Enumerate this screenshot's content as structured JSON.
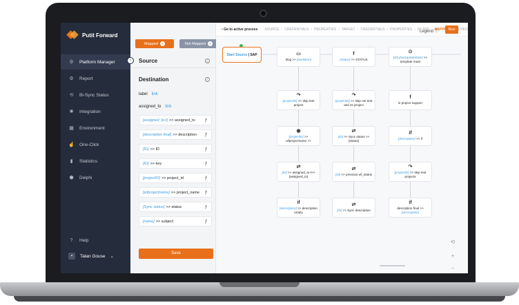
{
  "logo": {
    "text": "Putit Forward"
  },
  "sidebar": {
    "items": [
      {
        "label": "Platform Manager",
        "icon": "gear-icon",
        "glyph": "⚙"
      },
      {
        "label": "Report",
        "icon": "gear-icon",
        "glyph": "⚙"
      },
      {
        "label": "Bi-Sync Status",
        "icon": "sync-icon",
        "glyph": "⟲"
      },
      {
        "label": "Integration",
        "icon": "sun-icon",
        "glyph": "✺"
      },
      {
        "label": "Environment",
        "icon": "grid-icon",
        "glyph": "▦"
      },
      {
        "label": "One-Click",
        "icon": "pointer-icon",
        "glyph": "☝"
      },
      {
        "label": "Statistics",
        "icon": "bar-chart-icon",
        "glyph": "▮"
      },
      {
        "label": "Delphi",
        "icon": "cube-icon",
        "glyph": "⬢"
      }
    ],
    "help": "Help",
    "user": "Talan Gouse",
    "collapse_glyph": "‹",
    "user_caret": "⌄"
  },
  "panel": {
    "tabs": {
      "mapped": "Mapped",
      "mapped_count": "0",
      "not_mapped": "Not Mapped",
      "not_mapped_count": "0"
    },
    "source_title": "Source",
    "destination_title": "Destination",
    "fields": [
      {
        "key": "label",
        "value": "link"
      },
      {
        "key": "assigned_to",
        "value": "link"
      }
    ],
    "mappings": [
      {
        "src": "[assigned_to-t]",
        "dst": "assigned_to"
      },
      {
        "src": "[description final]",
        "dst": "description"
      },
      {
        "src": "[ID]",
        "dst": "ID"
      },
      {
        "src": "[ID]",
        "dst": "key"
      },
      {
        "src": "[projectID]",
        "dst": "project_id"
      },
      {
        "src": "[wfprojectname]",
        "dst": "project_name"
      },
      {
        "src": "[Sync status]",
        "dst": "status"
      },
      {
        "src": "[name]",
        "dst": "subject"
      }
    ],
    "save": "Save"
  },
  "topbar": {
    "back": "Go to active process",
    "crumbs": [
      "SOURCE",
      "CREDENTIALS",
      "PROPERTIES",
      "TARGET",
      "CREDENTIALS",
      "PROPERTIES",
      "FILTER",
      "MAPPING",
      "SCHEDULE"
    ],
    "active_crumb": "MAPPING",
    "legend": "Legend",
    "run": "Run"
  },
  "canvas": {
    "start": {
      "a": "Start Source",
      "b": "SAP"
    },
    "columns": [
      [
        {
          "icon": "▭",
          "pre": "Bug >> ",
          "b": "[workitem]",
          "post": ""
        },
        {
          "icon": "↷",
          "pre": "",
          "b": "[projectID]",
          "post": " >> skip test project"
        },
        {
          "icon": "◉",
          "pre": "",
          "b": "[projectID]",
          "post": " >> wfprojectname >>"
        },
        {
          "icon": "⇄",
          "pre": "",
          "b": "[ID]",
          "post": " >> assigned_to-t>> [assigned_to]"
        },
        {
          "icon": "if",
          "pre": "",
          "b": "[description]",
          "post": " >> description empty"
        }
      ],
      [
        {
          "icon": "f",
          "pre": "",
          "b": "[status]",
          "post": " >> STATUS"
        },
        {
          "icon": "↷",
          "pre": "",
          "b": "[projectID]",
          "post": " >> skip not test and zs project"
        },
        {
          "icon": "⇄",
          "pre": "",
          "b": "[ID]",
          "post": " >> Sync status >> [status]"
        },
        {
          "icon": "⇄",
          "pre": "",
          "b": "[ID]",
          "post": " >> previous wf_status"
        },
        {
          "icon": "⇄",
          "pre": "",
          "b": "[ID]",
          "post": " >> Sync description"
        }
      ],
      [
        {
          "icon": "⊙",
          "pre": "",
          "b": "[ID] [lastUpdateDate]",
          "post": " >> template route"
        },
        {
          "icon": "f",
          "pre": "is project support",
          "b": "",
          "post": ""
        },
        {
          "icon": "if",
          "pre": "",
          "b": "[description]",
          "post": " >> if"
        },
        {
          "icon": "↷",
          "pre": "",
          "b": "[projectID]",
          "post": " >> skip test projects"
        },
        {
          "icon": "if",
          "pre": "description final >> ",
          "b": "[description]",
          "post": ""
        }
      ]
    ]
  }
}
